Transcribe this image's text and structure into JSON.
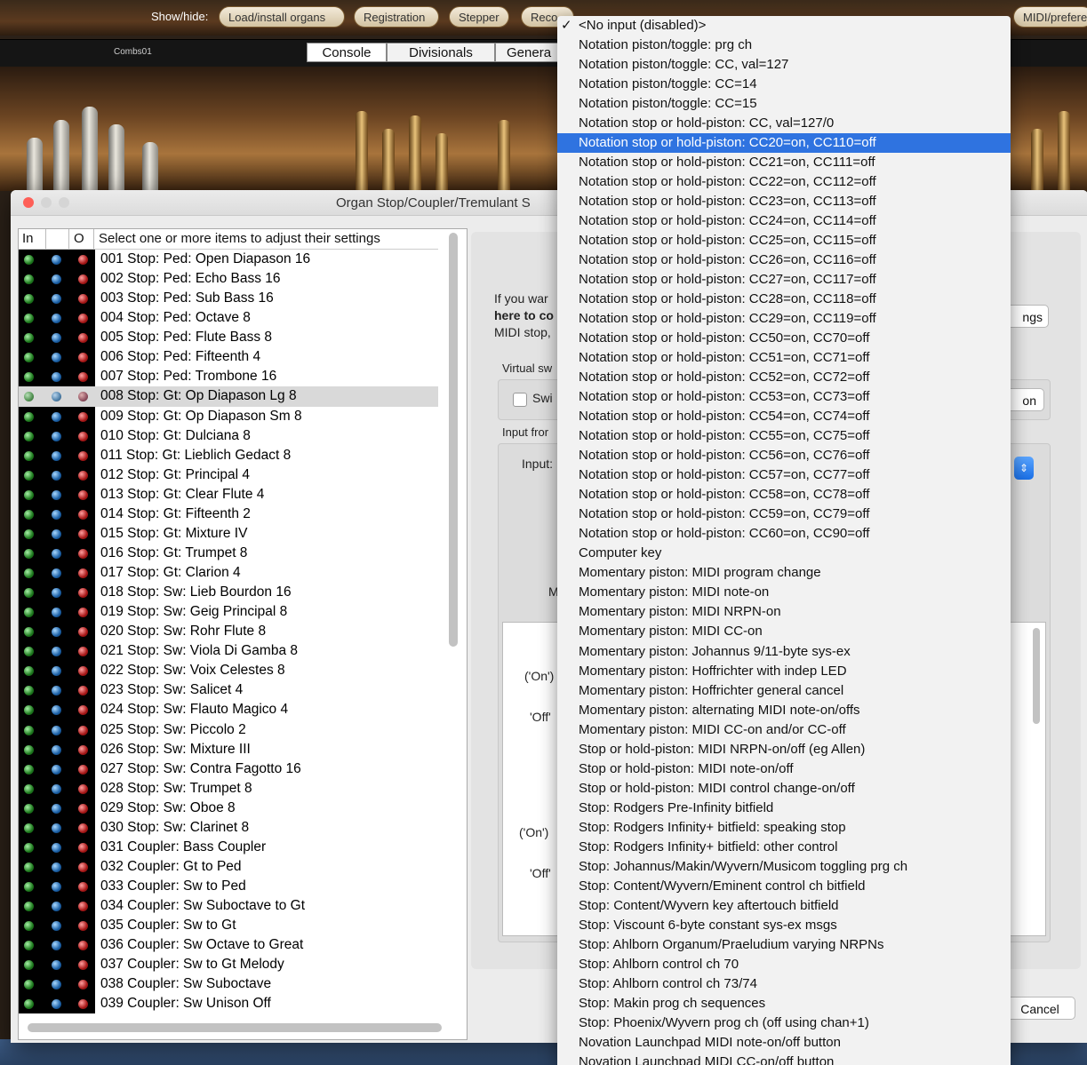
{
  "toolbar": {
    "show_hide_label": "Show/hide:",
    "buttons": [
      "Load/install organs",
      "Registration",
      "Stepper",
      "Reco",
      "",
      "",
      "",
      "MIDI/prefere"
    ]
  },
  "console_bar": {
    "combination_name": "Combs01",
    "tabs": [
      "Console",
      "Divisionals",
      "Genera"
    ]
  },
  "window": {
    "title": "Organ Stop/Coupler/Tremulant S"
  },
  "list": {
    "header_in": "In",
    "header_o": "O",
    "header_desc": "Select one or more items to adjust their settings",
    "items": [
      "001 Stop: Ped: Open Diapason 16",
      "002 Stop: Ped: Echo Bass 16",
      "003 Stop: Ped: Sub Bass 16",
      "004 Stop: Ped: Octave 8",
      "005 Stop: Ped: Flute Bass 8",
      "006 Stop: Ped: Fifteenth 4",
      "007 Stop: Ped: Trombone 16",
      "008 Stop: Gt: Op Diapason Lg 8",
      "009 Stop: Gt: Op Diapason Sm 8",
      "010 Stop: Gt: Dulciana 8",
      "011 Stop: Gt: Lieblich Gedact 8",
      "012 Stop: Gt: Principal 4",
      "013 Stop: Gt: Clear Flute 4",
      "014 Stop: Gt: Fifteenth 2",
      "015 Stop: Gt: Mixture IV",
      "016 Stop: Gt: Trumpet 8",
      "017 Stop: Gt: Clarion 4",
      "018 Stop: Sw: Lieb Bourdon 16",
      "019 Stop: Sw: Geig Principal 8",
      "020 Stop: Sw: Rohr Flute 8",
      "021 Stop: Sw: Viola Di Gamba 8",
      "022 Stop: Sw: Voix Celestes 8",
      "023 Stop: Sw: Salicet 4",
      "024 Stop: Sw: Flauto Magico 4",
      "025 Stop: Sw: Piccolo 2",
      "026 Stop: Sw: Mixture III",
      "027 Stop: Sw: Contra Fagotto 16",
      "028 Stop: Sw: Trumpet 8",
      "029 Stop: Sw: Oboe 8",
      "030 Stop: Sw: Clarinet 8",
      "031 Coupler: Bass Coupler",
      "032 Coupler: Gt to Ped",
      "033 Coupler: Sw to Ped",
      "034 Coupler: Sw Suboctave to Gt",
      "035 Coupler: Sw to Gt",
      "036 Coupler: Sw Octave to Great",
      "037 Coupler: Sw to Gt Melody",
      "038 Coupler: Sw Suboctave",
      "039 Coupler: Sw Unison Off"
    ],
    "selected_index": 7
  },
  "panel": {
    "intro_line1": "If you war",
    "intro_line2": "here to co",
    "intro_line3": "MIDI stop,",
    "settings_button": "ngs",
    "virtual_label": "Virtual sw",
    "switch_label": "Swi",
    "on_button": "on",
    "input_from_label": "Input fror",
    "input_label": "Input:",
    "m_label": "M",
    "on_label_1": "('On')",
    "off_label_1": "'Off'",
    "on_label_2": "('On')",
    "off_label_2": "'Off'",
    "cancel_button": "Cancel"
  },
  "menu": {
    "checked_index": 0,
    "highlighted_index": 6,
    "items": [
      "<No input (disabled)>",
      "Notation piston/toggle: prg ch",
      "Notation piston/toggle: CC, val=127",
      "Notation piston/toggle: CC=14",
      "Notation piston/toggle: CC=15",
      "Notation stop or hold-piston: CC, val=127/0",
      "Notation stop or hold-piston: CC20=on, CC110=off",
      "Notation stop or hold-piston: CC21=on, CC111=off",
      "Notation stop or hold-piston: CC22=on, CC112=off",
      "Notation stop or hold-piston: CC23=on, CC113=off",
      "Notation stop or hold-piston: CC24=on, CC114=off",
      "Notation stop or hold-piston: CC25=on, CC115=off",
      "Notation stop or hold-piston: CC26=on, CC116=off",
      "Notation stop or hold-piston: CC27=on, CC117=off",
      "Notation stop or hold-piston: CC28=on, CC118=off",
      "Notation stop or hold-piston: CC29=on, CC119=off",
      "Notation stop or hold-piston: CC50=on, CC70=off",
      "Notation stop or hold-piston: CC51=on, CC71=off",
      "Notation stop or hold-piston: CC52=on, CC72=off",
      "Notation stop or hold-piston: CC53=on, CC73=off",
      "Notation stop or hold-piston: CC54=on, CC74=off",
      "Notation stop or hold-piston: CC55=on, CC75=off",
      "Notation stop or hold-piston: CC56=on, CC76=off",
      "Notation stop or hold-piston: CC57=on, CC77=off",
      "Notation stop or hold-piston: CC58=on, CC78=off",
      "Notation stop or hold-piston: CC59=on, CC79=off",
      "Notation stop or hold-piston: CC60=on, CC90=off",
      "Computer key",
      "Momentary piston: MIDI program change",
      "Momentary piston: MIDI note-on",
      "Momentary piston: MIDI NRPN-on",
      "Momentary piston: MIDI CC-on",
      "Momentary piston: Johannus 9/11-byte sys-ex",
      "Momentary piston: Hoffrichter with indep LED",
      "Momentary piston: Hoffrichter general cancel",
      "Momentary piston: alternating MIDI note-on/offs",
      "Momentary piston: MIDI CC-on and/or CC-off",
      "Stop or hold-piston: MIDI NRPN-on/off (eg Allen)",
      "Stop or hold-piston: MIDI note-on/off",
      "Stop or hold-piston: MIDI control change-on/off",
      "Stop: Rodgers Pre-Infinity bitfield",
      "Stop: Rodgers Infinity+ bitfield: speaking stop",
      "Stop: Rodgers Infinity+ bitfield: other control",
      "Stop: Johannus/Makin/Wyvern/Musicom toggling prg ch",
      "Stop: Content/Wyvern/Eminent control ch bitfield",
      "Stop: Content/Wyvern key aftertouch bitfield",
      "Stop: Viscount 6-byte constant sys-ex msgs",
      "Stop: Ahlborn Organum/Praeludium varying NRPNs",
      "Stop: Ahlborn control ch 70",
      "Stop: Ahlborn control ch 73/74",
      "Stop: Makin prog ch sequences",
      "Stop: Phoenix/Wyvern prog ch (off using chan+1)",
      "Novation Launchpad MIDI note-on/off button",
      "Novation Launchpad MIDI CC-on/off button"
    ]
  },
  "colors": {
    "highlight": "#2f73e0",
    "window_bg": "#ececec",
    "close_button": "#fe5f57"
  }
}
